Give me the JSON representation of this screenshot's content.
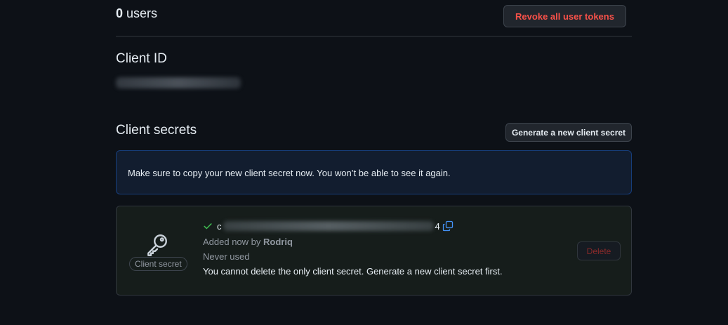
{
  "users": {
    "count": "0",
    "label": "users",
    "revoke_label": "Revoke all user tokens"
  },
  "client_id": {
    "title": "Client ID"
  },
  "client_secrets": {
    "title": "Client secrets",
    "generate_label": "Generate a new client secret",
    "flash_message": "Make sure to copy your new client secret now. You won’t be able to see it again.",
    "secret": {
      "badge_label": "Client secret",
      "value_prefix": "c",
      "value_suffix": "4",
      "added_prefix": "Added now by ",
      "added_by": "Rodriq",
      "usage": "Never used",
      "warning": "You cannot delete the only client secret. Generate a new client secret first.",
      "delete_label": "Delete"
    }
  },
  "icons": {
    "key": "key-icon",
    "check": "check-icon",
    "copy": "copy-icon"
  },
  "colors": {
    "danger": "#f85149",
    "success": "#3fb950",
    "accent": "#4493f8",
    "background": "#0d1117"
  }
}
